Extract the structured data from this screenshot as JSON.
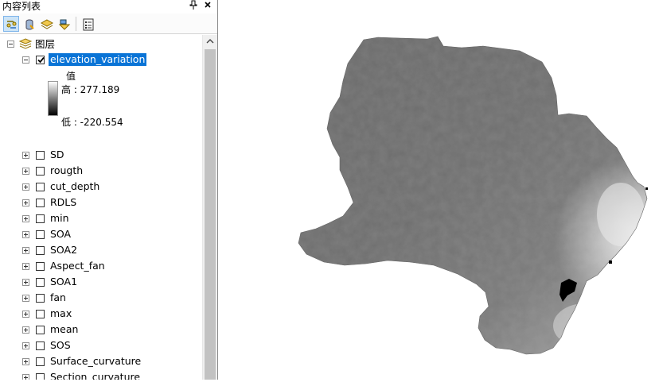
{
  "toc": {
    "title": "内容列表",
    "pin_icon": "pin-icon",
    "close_icon": "close-icon",
    "toolbar": [
      {
        "name": "list-by-drawing-order-button",
        "icon": "drawing-order-icon",
        "active": true
      },
      {
        "name": "list-by-source-button",
        "icon": "source-icon",
        "active": false
      },
      {
        "name": "list-by-visibility-button",
        "icon": "visibility-icon",
        "active": false
      },
      {
        "name": "list-by-selection-button",
        "icon": "selection-icon",
        "active": false
      },
      {
        "name": "options-button",
        "icon": "options-icon",
        "active": false
      }
    ],
    "group_label": "图层",
    "active_layer": {
      "label": "elevation_variation",
      "checked": true,
      "legend": {
        "field": "值",
        "high": "高 : 277.189",
        "low": "低 : -220.554"
      }
    },
    "layers": [
      {
        "label": "SD",
        "checked": false
      },
      {
        "label": "rougth",
        "checked": false
      },
      {
        "label": "cut_depth",
        "checked": false
      },
      {
        "label": "RDLS",
        "checked": false
      },
      {
        "label": "min",
        "checked": false
      },
      {
        "label": "SOA",
        "checked": false
      },
      {
        "label": "SOA2",
        "checked": false
      },
      {
        "label": "Aspect_fan",
        "checked": false
      },
      {
        "label": "SOA1",
        "checked": false
      },
      {
        "label": "fan",
        "checked": false
      },
      {
        "label": "max",
        "checked": false
      },
      {
        "label": "mean",
        "checked": false
      },
      {
        "label": "SOS",
        "checked": false
      },
      {
        "label": "Surface_curvature",
        "checked": false
      },
      {
        "label": "Section_curvature",
        "checked": false
      }
    ]
  },
  "colors": {
    "selection": "#0a74d6",
    "raster_mid": "#727272",
    "raster_dark": "#5f5f5f",
    "raster_light": "#e6e6e6"
  }
}
